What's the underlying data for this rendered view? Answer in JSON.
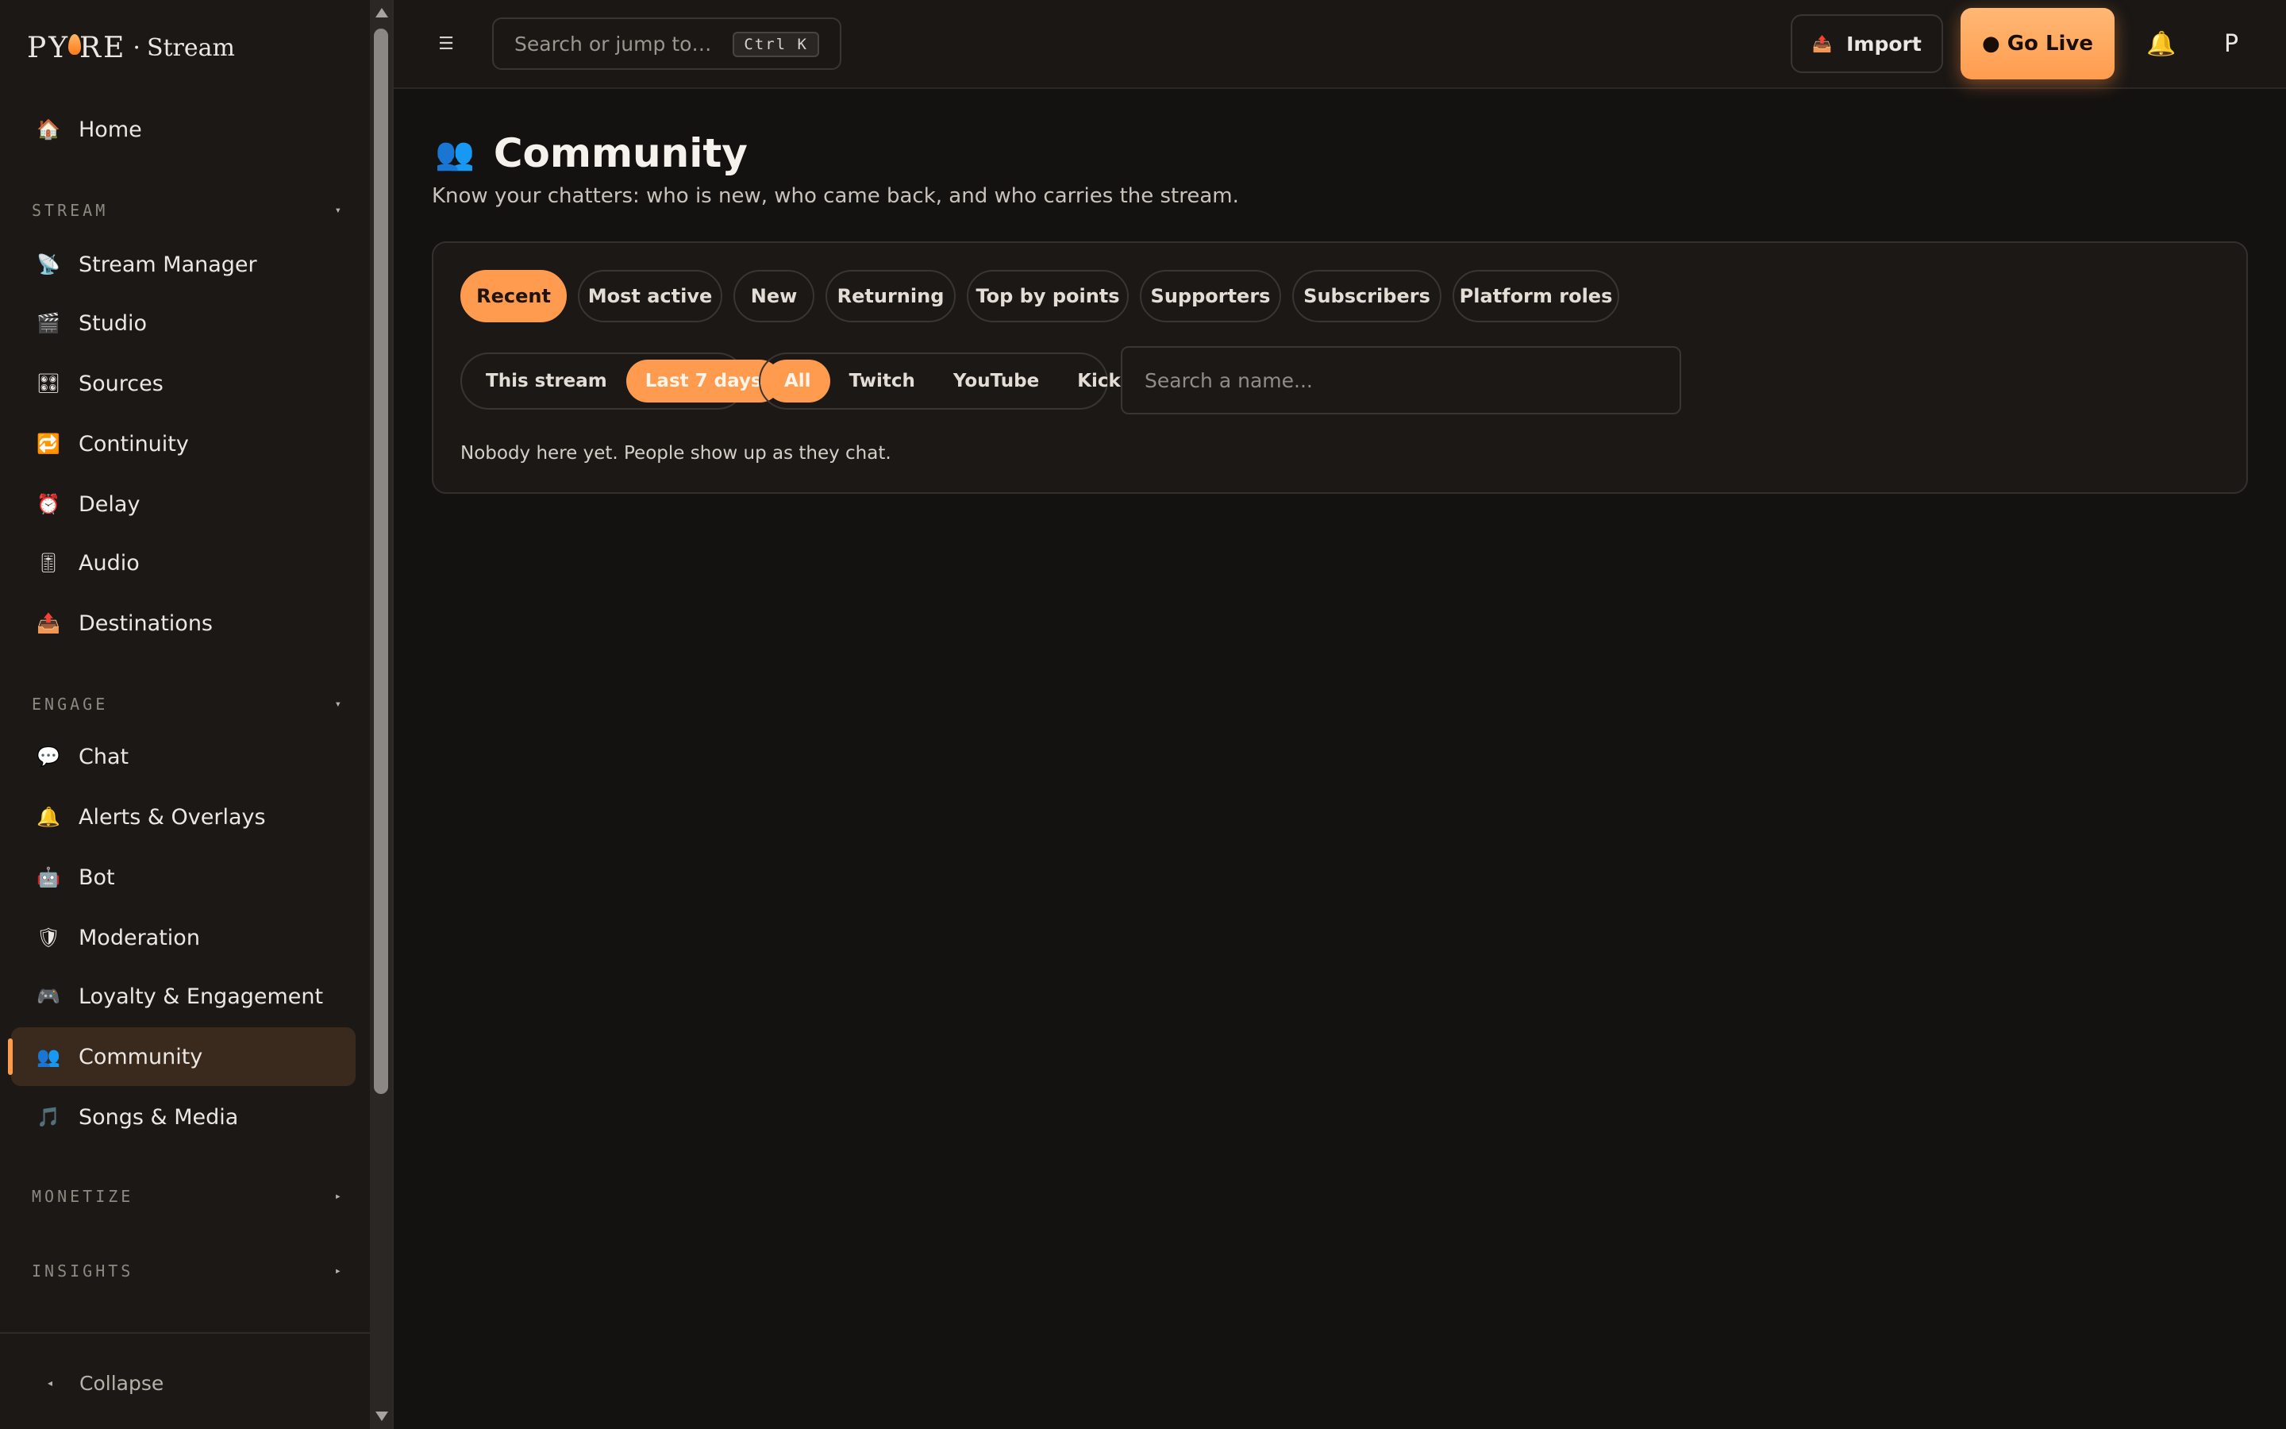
{
  "brand": {
    "name_left": "P",
    "name_right": "RE",
    "separator": "·",
    "sub": "Stream"
  },
  "sidebar": {
    "home": {
      "icon": "🏠",
      "label": "Home"
    },
    "stream_section": {
      "title": "STREAM",
      "arrow": "▾"
    },
    "stream_items": [
      {
        "icon": "📡",
        "label": "Stream Manager"
      },
      {
        "icon": "🎬",
        "label": "Studio"
      },
      {
        "icon": "🎛",
        "label": "Sources"
      },
      {
        "icon": "🔁",
        "label": "Continuity"
      },
      {
        "icon": "⏰",
        "label": "Delay"
      },
      {
        "icon": "🎚",
        "label": "Audio"
      },
      {
        "icon": "📤",
        "label": "Destinations"
      }
    ],
    "engage_section": {
      "title": "ENGAGE",
      "arrow": "▾"
    },
    "engage_items": [
      {
        "icon": "💬",
        "label": "Chat"
      },
      {
        "icon": "🔔",
        "label": "Alerts & Overlays"
      },
      {
        "icon": "🤖",
        "label": "Bot"
      },
      {
        "icon": "🛡",
        "label": "Moderation"
      },
      {
        "icon": "🎮",
        "label": "Loyalty & Engagement"
      },
      {
        "icon": "👥",
        "label": "Community"
      },
      {
        "icon": "🎵",
        "label": "Songs & Media"
      }
    ],
    "monetize_section": {
      "title": "MONETIZE",
      "arrow": "▸"
    },
    "insights_section": {
      "title": "INSIGHTS",
      "arrow": "▸"
    },
    "collapse": {
      "arrow": "◂",
      "label": "Collapse"
    }
  },
  "topbar": {
    "menu_icon": "☰",
    "search": {
      "placeholder": "Search or jump to…",
      "shortcut": "Ctrl K"
    },
    "import": {
      "icon": "📤",
      "label": "Import"
    },
    "go_live": {
      "label": "● Go Live"
    },
    "bell_icon": "🔔",
    "avatar": "P"
  },
  "main": {
    "title_icon": "👥",
    "title": "Community",
    "subtitle": "Know your chatters: who is new, who came back, and who carries the stream.",
    "filters": [
      "Recent",
      "Most active",
      "New",
      "Returning",
      "Top by points",
      "Supporters",
      "Subscribers",
      "Platform roles"
    ],
    "active_filter": "Recent",
    "ranges": [
      "This stream",
      "Last 7 days"
    ],
    "active_range": "Last 7 days",
    "platforms": [
      "All",
      "Twitch",
      "YouTube",
      "Kick"
    ],
    "active_platform": "All",
    "name_search_placeholder": "Search a name...",
    "empty_note": "Nobody here yet. People show up as they chat."
  },
  "colors": {
    "accent": "#ff9b4f",
    "background": "#141211",
    "sidebar": "#1b1816",
    "active_nav": "#3a2a1e",
    "bell": "#f1b93c"
  }
}
